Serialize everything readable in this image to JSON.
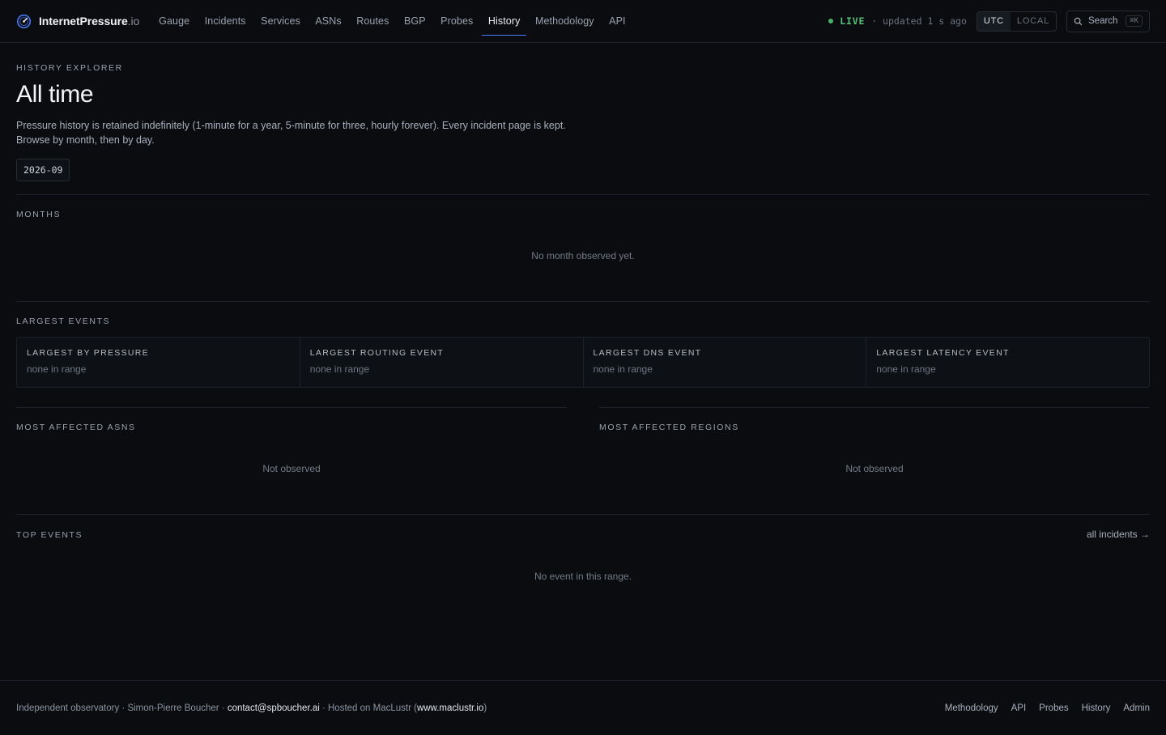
{
  "brand": {
    "name": "InternetPressure",
    "tld": ".io"
  },
  "nav": {
    "items": [
      {
        "label": "Gauge"
      },
      {
        "label": "Incidents"
      },
      {
        "label": "Services"
      },
      {
        "label": "ASNs"
      },
      {
        "label": "Routes"
      },
      {
        "label": "BGP"
      },
      {
        "label": "Probes"
      },
      {
        "label": "History",
        "active": true
      },
      {
        "label": "Methodology"
      },
      {
        "label": "API"
      }
    ]
  },
  "status": {
    "live": "LIVE",
    "updated": "· updated 1 s ago",
    "dot_color": "#4caf68"
  },
  "timezone": {
    "utc": "UTC",
    "local": "LOCAL",
    "selected": "UTC"
  },
  "search": {
    "label": "Search",
    "shortcut": "⌘K"
  },
  "page": {
    "eyebrow": "HISTORY EXPLORER",
    "title": "All time",
    "description_line1": "Pressure history is retained indefinitely (1-minute for a year, 5-minute for three, hourly forever). Every incident page is kept.",
    "description_line2": "Browse by month, then by day.",
    "month_chip": "2026-09"
  },
  "months": {
    "label": "MONTHS",
    "empty": "No month observed yet."
  },
  "largest_events": {
    "label": "LARGEST EVENTS",
    "cards": [
      {
        "title": "LARGEST BY PRESSURE",
        "value": "none in range"
      },
      {
        "title": "LARGEST ROUTING EVENT",
        "value": "none in range"
      },
      {
        "title": "LARGEST DNS EVENT",
        "value": "none in range"
      },
      {
        "title": "LARGEST LATENCY EVENT",
        "value": "none in range"
      }
    ]
  },
  "affected_asns": {
    "label": "MOST AFFECTED ASNS",
    "empty": "Not observed"
  },
  "affected_regions": {
    "label": "MOST AFFECTED REGIONS",
    "empty": "Not observed"
  },
  "top_events": {
    "label": "TOP EVENTS",
    "link": "all incidents →",
    "empty": "No event in this range."
  },
  "footer": {
    "prefix": "Independent observatory · Simon-Pierre Boucher · ",
    "email": "contact@spboucher.ai",
    "hosted": " · Hosted on MacLustr (",
    "host_link": "www.maclustr.io",
    "suffix": ")",
    "links": [
      "Methodology",
      "API",
      "Probes",
      "History",
      "Admin"
    ]
  },
  "colors": {
    "accent": "#4c7dff",
    "live": "#57c07a",
    "background": "#0a0c10"
  }
}
